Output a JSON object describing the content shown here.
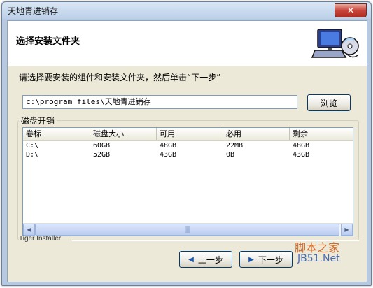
{
  "window": {
    "title": "天地青进销存",
    "close_label": "✕"
  },
  "header": {
    "title": "选择安装文件夹",
    "icon": "computer-cd-icon"
  },
  "instruction": "请选择要安装的组件和安装文件夹，然后单击“下一步”",
  "path": {
    "value": "c:\\program files\\天地青进销存"
  },
  "browse_label": "浏览",
  "disk_group": {
    "label": "磁盘开销",
    "columns": [
      "卷标",
      "磁盘大小",
      "可用",
      "必用",
      "剩余"
    ],
    "rows": [
      [
        "C:\\",
        "60GB",
        "48GB",
        "22MB",
        "48GB"
      ],
      [
        "D:\\",
        "52GB",
        "43GB",
        "0B",
        "43GB"
      ]
    ],
    "scroll_thumb": "||||"
  },
  "footer": {
    "label": "Tiger Installer"
  },
  "buttons": {
    "prev": "上一步",
    "next": "下一步"
  },
  "watermark": {
    "line1": "脚本之家",
    "line2": "JB51.Net"
  },
  "colors": {
    "client_bg": "#ece9d8",
    "accent": "#1a58b0",
    "close_red": "#c8453a"
  }
}
